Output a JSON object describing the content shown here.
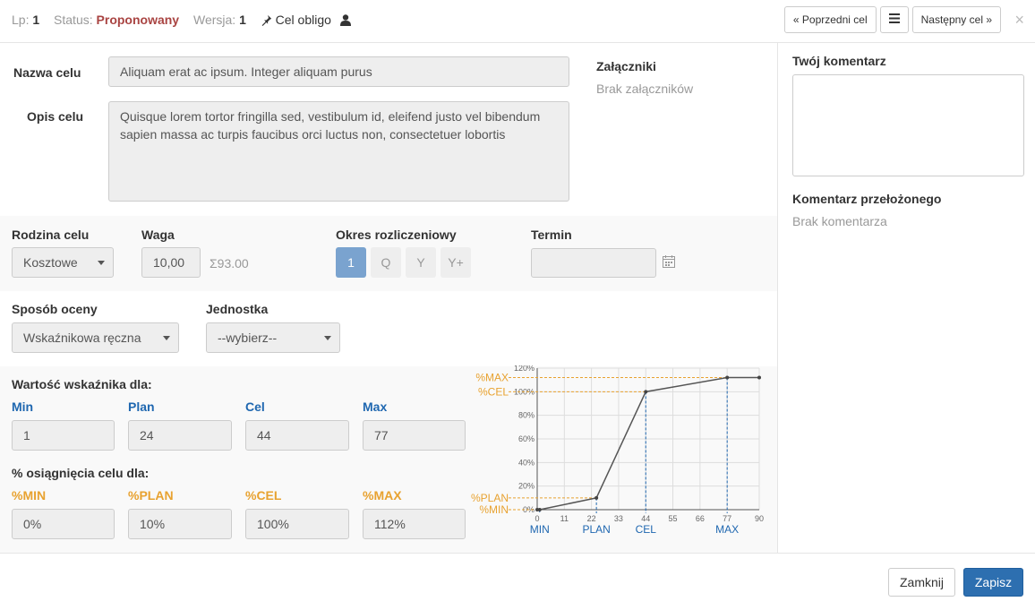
{
  "header": {
    "lp_label": "Lp:",
    "lp_value": "1",
    "status_label": "Status:",
    "status_value": "Proponowany",
    "version_label": "Wersja:",
    "version_value": "1",
    "goal_type": "Cel obligo",
    "prev_button": "« Poprzedni cel",
    "next_button": "Następny cel »",
    "close": "×"
  },
  "goal": {
    "name_label": "Nazwa celu",
    "name_value": "Aliquam erat ac ipsum. Integer aliquam purus",
    "desc_label": "Opis celu",
    "desc_value": "Quisque lorem tortor fringilla sed, vestibulum id, eleifend justo vel bibendum sapien massa ac turpis faucibus orci luctus non, consectetuer lobortis",
    "attachments_label": "Załączniki",
    "attachments_value": "Brak załączników"
  },
  "params": {
    "family_label": "Rodzina celu",
    "family_value": "Kosztowe",
    "weight_label": "Waga",
    "weight_value": "10,00",
    "weight_sum": "Σ93.00",
    "period_label": "Okres rozliczeniowy",
    "period_options": [
      "1",
      "Q",
      "Y",
      "Y+"
    ],
    "period_selected": "1",
    "deadline_label": "Termin",
    "deadline_value": ""
  },
  "evaluation": {
    "method_label": "Sposób oceny",
    "method_value": "Wskaźnikowa ręczna",
    "unit_label": "Jednostka",
    "unit_value": "--wybierz--"
  },
  "indicator": {
    "values_title": "Wartość wskaźnika dla:",
    "min_label": "Min",
    "plan_label": "Plan",
    "cel_label": "Cel",
    "max_label": "Max",
    "min_value": "1",
    "plan_value": "24",
    "cel_value": "44",
    "max_value": "77",
    "pct_title": "% osiągnięcia celu dla:",
    "pmin_label": "%MIN",
    "pplan_label": "%PLAN",
    "pcel_label": "%CEL",
    "pmax_label": "%MAX",
    "pmin_value": "0%",
    "pplan_value": "10%",
    "pcel_value": "100%",
    "pmax_value": "112%"
  },
  "chart_data": {
    "type": "line",
    "x": [
      0,
      1,
      24,
      44,
      77,
      90
    ],
    "y": [
      0,
      0,
      10,
      100,
      112,
      112
    ],
    "xlim": [
      0,
      90
    ],
    "ylim": [
      0,
      120
    ],
    "xticks": [
      "0",
      "11",
      "22",
      "33",
      "44",
      "55",
      "66",
      "77",
      "90"
    ],
    "xtick_values": [
      0,
      11,
      22,
      33,
      44,
      55,
      66,
      77,
      90
    ],
    "yticks": [
      "0%",
      "20%",
      "40%",
      "60%",
      "80%",
      "100%",
      "120%"
    ],
    "ytick_values": [
      0,
      20,
      40,
      60,
      80,
      100,
      120
    ],
    "x_markers": [
      {
        "label": "MIN",
        "x": 1
      },
      {
        "label": "PLAN",
        "x": 24
      },
      {
        "label": "CEL",
        "x": 44
      },
      {
        "label": "MAX",
        "x": 77
      }
    ],
    "y_markers": [
      {
        "label": "%MIN",
        "y": 0
      },
      {
        "label": "%PLAN",
        "y": 10
      },
      {
        "label": "%CEL",
        "y": 100
      },
      {
        "label": "%MAX",
        "y": 112
      }
    ],
    "grid": true,
    "line_color": "#555555",
    "x_marker_color": "#1f67b0",
    "y_marker_color": "#e8a230"
  },
  "comments": {
    "your_comment_label": "Twój komentarz",
    "your_comment_value": "",
    "manager_comment_label": "Komentarz przełożonego",
    "manager_comment_value": "Brak komentarza"
  },
  "footer": {
    "close_button": "Zamknij",
    "save_button": "Zapisz"
  }
}
